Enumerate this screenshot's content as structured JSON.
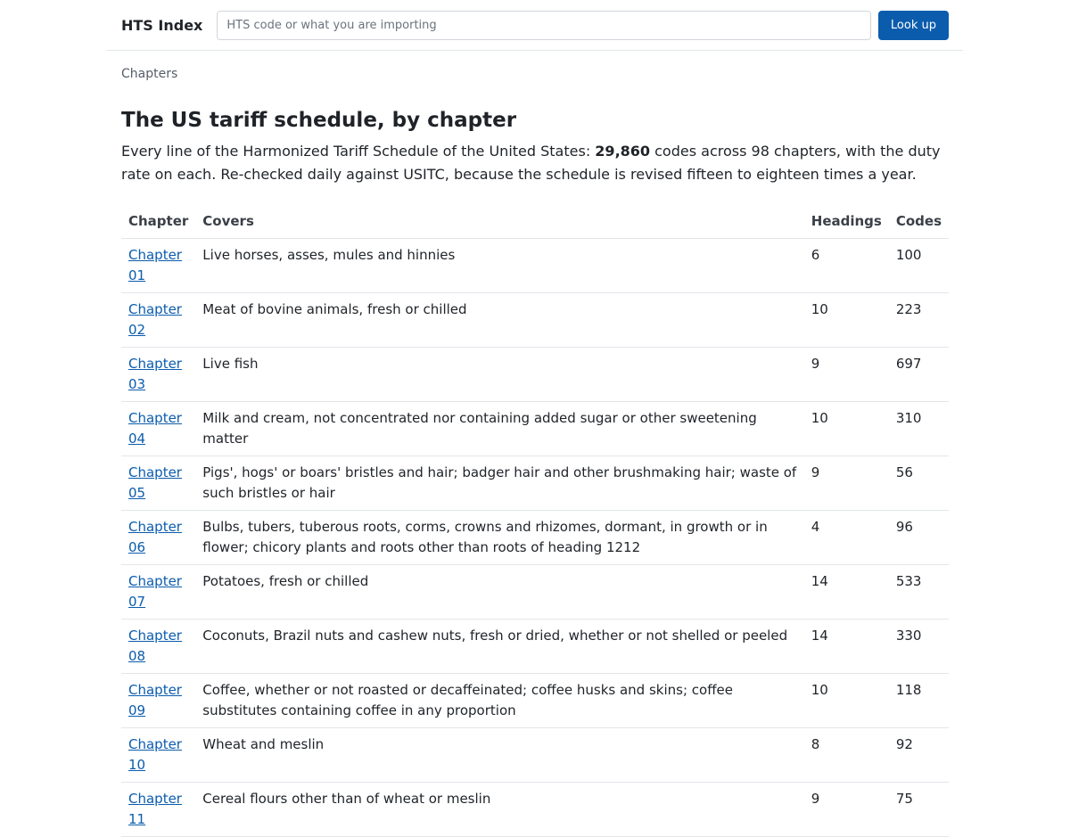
{
  "header": {
    "brand": "HTS Index",
    "search_placeholder": "HTS code or what you are importing",
    "lookup_label": "Look up"
  },
  "breadcrumb": "Chapters",
  "title": "The US tariff schedule, by chapter",
  "intro": {
    "before": "Every line of the Harmonized Tariff Schedule of the United States: ",
    "count": "29,860",
    "after": " codes across 98 chapters, with the duty rate on each. Re-checked daily against USITC, because the schedule is revised fifteen to eighteen times a year."
  },
  "table": {
    "headers": [
      "Chapter",
      "Covers",
      "Headings",
      "Codes"
    ],
    "rows": [
      {
        "chapter": "Chapter 01",
        "covers": "Live horses, asses, mules and hinnies",
        "headings": "6",
        "codes": "100"
      },
      {
        "chapter": "Chapter 02",
        "covers": "Meat of bovine animals, fresh or chilled",
        "headings": "10",
        "codes": "223"
      },
      {
        "chapter": "Chapter 03",
        "covers": "Live fish",
        "headings": "9",
        "codes": "697"
      },
      {
        "chapter": "Chapter 04",
        "covers": "Milk and cream, not concentrated nor containing added sugar or other sweetening matter",
        "headings": "10",
        "codes": "310"
      },
      {
        "chapter": "Chapter 05",
        "covers": "Pigs', hogs' or boars' bristles and hair; badger hair and other brushmaking hair; waste of such bristles or hair",
        "headings": "9",
        "codes": "56"
      },
      {
        "chapter": "Chapter 06",
        "covers": "Bulbs, tubers, tuberous roots, corms, crowns and rhizomes, dormant, in growth or in flower; chicory plants and roots other than roots of heading 1212",
        "headings": "4",
        "codes": "96"
      },
      {
        "chapter": "Chapter 07",
        "covers": "Potatoes, fresh or chilled",
        "headings": "14",
        "codes": "533"
      },
      {
        "chapter": "Chapter 08",
        "covers": "Coconuts, Brazil nuts and cashew nuts, fresh or dried, whether or not shelled or peeled",
        "headings": "14",
        "codes": "330"
      },
      {
        "chapter": "Chapter 09",
        "covers": "Coffee, whether or not roasted or decaffeinated; coffee husks and skins; coffee substitutes containing coffee in any proportion",
        "headings": "10",
        "codes": "118"
      },
      {
        "chapter": "Chapter 10",
        "covers": "Wheat and meslin",
        "headings": "8",
        "codes": "92"
      },
      {
        "chapter": "Chapter 11",
        "covers": "Cereal flours other than of wheat or meslin",
        "headings": "9",
        "codes": "75"
      }
    ]
  }
}
